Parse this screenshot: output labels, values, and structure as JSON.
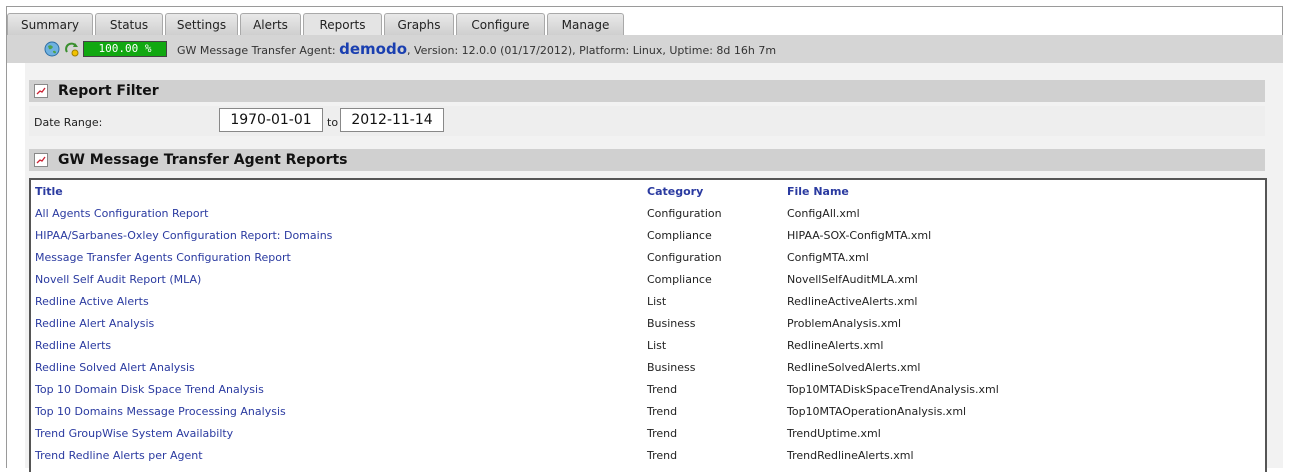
{
  "tabs": [
    {
      "label": "Summary"
    },
    {
      "label": "Status"
    },
    {
      "label": "Settings"
    },
    {
      "label": "Alerts"
    },
    {
      "label": "Reports",
      "active": true
    },
    {
      "label": "Graphs"
    },
    {
      "label": "Configure"
    },
    {
      "label": "Manage"
    }
  ],
  "status": {
    "percent": "100.00 %",
    "prefix": "GW Message Transfer Agent:",
    "agent": "demodo",
    "details": ", Version: 12.0.0 (01/17/2012), Platform: Linux, Uptime: 8d 16h 7m"
  },
  "filter": {
    "title": "Report Filter",
    "date_label": "Date Range:",
    "from": "1970-01-01",
    "to_label": "to",
    "to": "2012-11-14"
  },
  "reports": {
    "title": "GW Message Transfer Agent Reports",
    "headers": {
      "title": "Title",
      "category": "Category",
      "file": "File Name"
    },
    "rows": [
      {
        "title": "All Agents Configuration Report",
        "category": "Configuration",
        "file": "ConfigAll.xml"
      },
      {
        "title": "HIPAA/Sarbanes-Oxley Configuration Report: Domains",
        "category": "Compliance",
        "file": "HIPAA-SOX-ConfigMTA.xml"
      },
      {
        "title": "Message Transfer Agents Configuration Report",
        "category": "Configuration",
        "file": "ConfigMTA.xml"
      },
      {
        "title": "Novell Self Audit Report (MLA)",
        "category": "Compliance",
        "file": "NovellSelfAuditMLA.xml"
      },
      {
        "title": "Redline Active Alerts",
        "category": "List",
        "file": "RedlineActiveAlerts.xml"
      },
      {
        "title": "Redline Alert Analysis",
        "category": "Business",
        "file": "ProblemAnalysis.xml"
      },
      {
        "title": "Redline Alerts",
        "category": "List",
        "file": "RedlineAlerts.xml"
      },
      {
        "title": "Redline Solved Alert Analysis",
        "category": "Business",
        "file": "RedlineSolvedAlerts.xml"
      },
      {
        "title": "Top 10 Domain Disk Space Trend Analysis",
        "category": "Trend",
        "file": "Top10MTADiskSpaceTrendAnalysis.xml"
      },
      {
        "title": "Top 10 Domains Message Processing Analysis",
        "category": "Trend",
        "file": "Top10MTAOperationAnalysis.xml"
      },
      {
        "title": "Trend GroupWise System Availabilty",
        "category": "Trend",
        "file": "TrendUptime.xml"
      },
      {
        "title": "Trend Redline Alerts per Agent",
        "category": "Trend",
        "file": "TrendRedlineAlerts.xml"
      }
    ]
  },
  "colors": {
    "accent": "#2a3aa0",
    "status_green": "#11a811",
    "agent_name": "#1a3fb0"
  }
}
